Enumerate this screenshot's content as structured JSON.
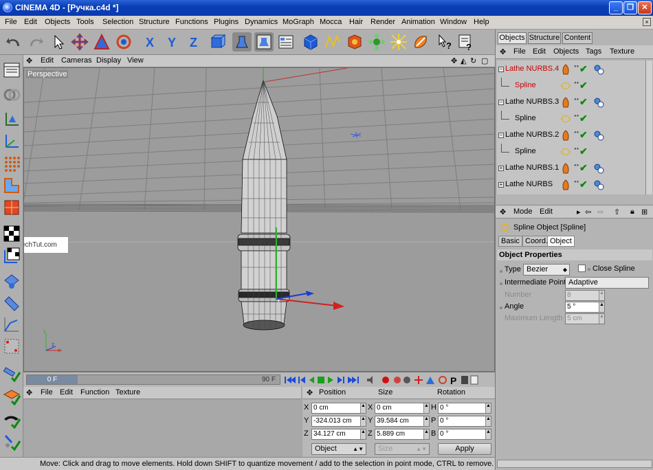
{
  "window": {
    "title": "CINEMA 4D - [Ручка.c4d *]"
  },
  "menubar": [
    "File",
    "Edit",
    "Objects",
    "Tools",
    "Selection",
    "Structure",
    "Functions",
    "Plugins",
    "Dynamics",
    "MoGraph",
    "Mocca",
    "Hair",
    "Render",
    "Animation",
    "Window",
    "Help"
  ],
  "viewport": {
    "menu": [
      "Edit",
      "Cameras",
      "Display",
      "View"
    ],
    "label": "Perspective",
    "watermark": "TechTut.com"
  },
  "timeline": {
    "current_frame": "0 F",
    "end_frame": "90 F"
  },
  "materials": {
    "menu": [
      "File",
      "Edit",
      "Function",
      "Texture"
    ]
  },
  "coordinates": {
    "headers": [
      "Position",
      "Size",
      "Rotation"
    ],
    "rows": [
      {
        "pos_axis": "X",
        "pos": "0 cm",
        "size_axis": "X",
        "size": "0 cm",
        "rot_axis": "H",
        "rot": "0 °"
      },
      {
        "pos_axis": "Y",
        "pos": "-324.013 cm",
        "size_axis": "Y",
        "size": "39.584 cm",
        "rot_axis": "P",
        "rot": "0 °"
      },
      {
        "pos_axis": "Z",
        "pos": "34.127 cm",
        "size_axis": "Z",
        "size": "5.889 cm",
        "rot_axis": "B",
        "rot": "0 °"
      }
    ],
    "mode": "Object",
    "size_mode": "Size",
    "apply": "Apply"
  },
  "status": {
    "text": "Move: Click and drag to move elements. Hold down SHIFT to quantize movement / add to the selection in point mode, CTRL to remove."
  },
  "right_tabs": [
    "Objects",
    "Structure",
    "Content"
  ],
  "object_manager": {
    "menu": [
      "File",
      "Edit",
      "Objects",
      "Tags",
      "Texture"
    ],
    "objects": [
      {
        "name": "Lathe NURBS.4",
        "selected": true,
        "child": false,
        "expand": "−"
      },
      {
        "name": "Spline",
        "selected": true,
        "child": true,
        "expand": ""
      },
      {
        "name": "Lathe NURBS.3",
        "selected": false,
        "child": false,
        "expand": "−"
      },
      {
        "name": "Spline",
        "selected": false,
        "child": true,
        "expand": ""
      },
      {
        "name": "Lathe NURBS.2",
        "selected": false,
        "child": false,
        "expand": "−"
      },
      {
        "name": "Spline",
        "selected": false,
        "child": true,
        "expand": ""
      },
      {
        "name": "Lathe NURBS.1",
        "selected": false,
        "child": false,
        "expand": "+"
      },
      {
        "name": "Lathe NURBS",
        "selected": false,
        "child": false,
        "expand": "+"
      }
    ]
  },
  "attribute_manager": {
    "menu": [
      "Mode",
      "Edit"
    ],
    "title": "Spline Object [Spline]",
    "tabs": [
      "Basic",
      "Coord.",
      "Object"
    ],
    "section": "Object Properties",
    "type_label": "Type",
    "type_value": "Bezier",
    "close_spline": "Close Spline",
    "intermediate_label": "Intermediate Points",
    "intermediate_value": "Adaptive",
    "number_label": "Number",
    "number_value": "8",
    "angle_label": "Angle",
    "angle_value": "5 °",
    "maxlen_label": "Maximum Length",
    "maxlen_value": "5 cm"
  }
}
